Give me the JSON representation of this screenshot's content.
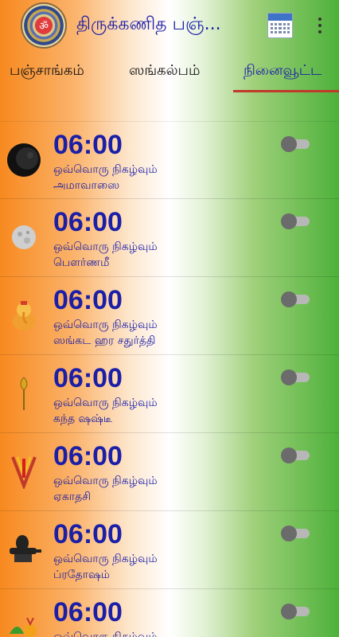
{
  "app": {
    "title": "திருக்கணித பஞ்...",
    "logo_symbol": "ॐ"
  },
  "tabs": [
    {
      "label": "பஞ்சாங்கம்",
      "active": false
    },
    {
      "label": "ஸங்கல்பம்",
      "active": false
    },
    {
      "label": "நினைவூட்ட",
      "active": true
    }
  ],
  "reminders": [
    {
      "time": "06:00",
      "repeat": "ஒவ்வொரு நிகழ்வும்",
      "event": "அமாவாஸை",
      "icon": "new-moon-icon",
      "enabled": false
    },
    {
      "time": "06:00",
      "repeat": "ஒவ்வொரு நிகழ்வும்",
      "event": "பௌர்ணமீ",
      "icon": "full-moon-icon",
      "enabled": false
    },
    {
      "time": "06:00",
      "repeat": "ஒவ்வொரு நிகழ்வும்",
      "event": "ஸங்கட ஹர சதுர்த்தி",
      "icon": "ganesha-icon",
      "enabled": false
    },
    {
      "time": "06:00",
      "repeat": "ஒவ்வொரு நிகழ்வும்",
      "event": "கந்த ஷஷ்டீ",
      "icon": "vel-spear-icon",
      "enabled": false
    },
    {
      "time": "06:00",
      "repeat": "ஒவ்வொரு நிகழ்வும்",
      "event": "ஏகாதசி",
      "icon": "namam-icon",
      "enabled": false
    },
    {
      "time": "06:00",
      "repeat": "ஒவ்வொரு நிகழ்வும்",
      "event": "ப்ரதோஷம்",
      "icon": "shiva-lingam-icon",
      "enabled": false
    },
    {
      "time": "06:00",
      "repeat": "ஒவ்வொரு நிகழ்வும்",
      "event": "",
      "icon": "festival-icon",
      "enabled": false
    }
  ],
  "colors": {
    "accent_text": "#1b1fa8",
    "tab_indicator": "#c0392b",
    "saffron": "#f7891f",
    "green": "#4db13a"
  }
}
